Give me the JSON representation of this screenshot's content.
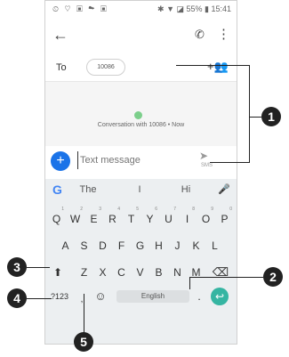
{
  "statusbar": {
    "left_icons": "⏲ ♡ ▣ ☁ ▣",
    "right": "✱ ▼ ◪ 55% ▮ 15:41"
  },
  "appbar": {
    "back_icon": "←",
    "call_icon": "✆",
    "more_icon": "⋮"
  },
  "to": {
    "label": "To",
    "chip": "10086",
    "add_icon": "+👥"
  },
  "conversation": {
    "text": "Conversation with 10086 • Now"
  },
  "compose": {
    "add_icon": "+",
    "placeholder": "Text message",
    "send_icon": "➤",
    "sms_label": "SMS"
  },
  "keyboard": {
    "logo": "G",
    "suggestions": [
      "The",
      "I",
      "Hi"
    ],
    "mic_icon": "🎤",
    "row1": [
      {
        "k": "Q",
        "n": "1"
      },
      {
        "k": "W",
        "n": "2"
      },
      {
        "k": "E",
        "n": "3"
      },
      {
        "k": "R",
        "n": "4"
      },
      {
        "k": "T",
        "n": "5"
      },
      {
        "k": "Y",
        "n": "6"
      },
      {
        "k": "U",
        "n": "7"
      },
      {
        "k": "I",
        "n": "8"
      },
      {
        "k": "O",
        "n": "9"
      },
      {
        "k": "P",
        "n": "0"
      }
    ],
    "row2": [
      "A",
      "S",
      "D",
      "F",
      "G",
      "H",
      "J",
      "K",
      "L"
    ],
    "row3": [
      "Z",
      "X",
      "C",
      "V",
      "B",
      "N",
      "M"
    ],
    "shift": "⬆",
    "backspace": "⌫",
    "symbols": "?123",
    "comma": ",",
    "emoji": "☺",
    "space": "English",
    "period": ".",
    "enter": "↩"
  },
  "callouts": [
    "1",
    "2",
    "3",
    "4",
    "5"
  ]
}
